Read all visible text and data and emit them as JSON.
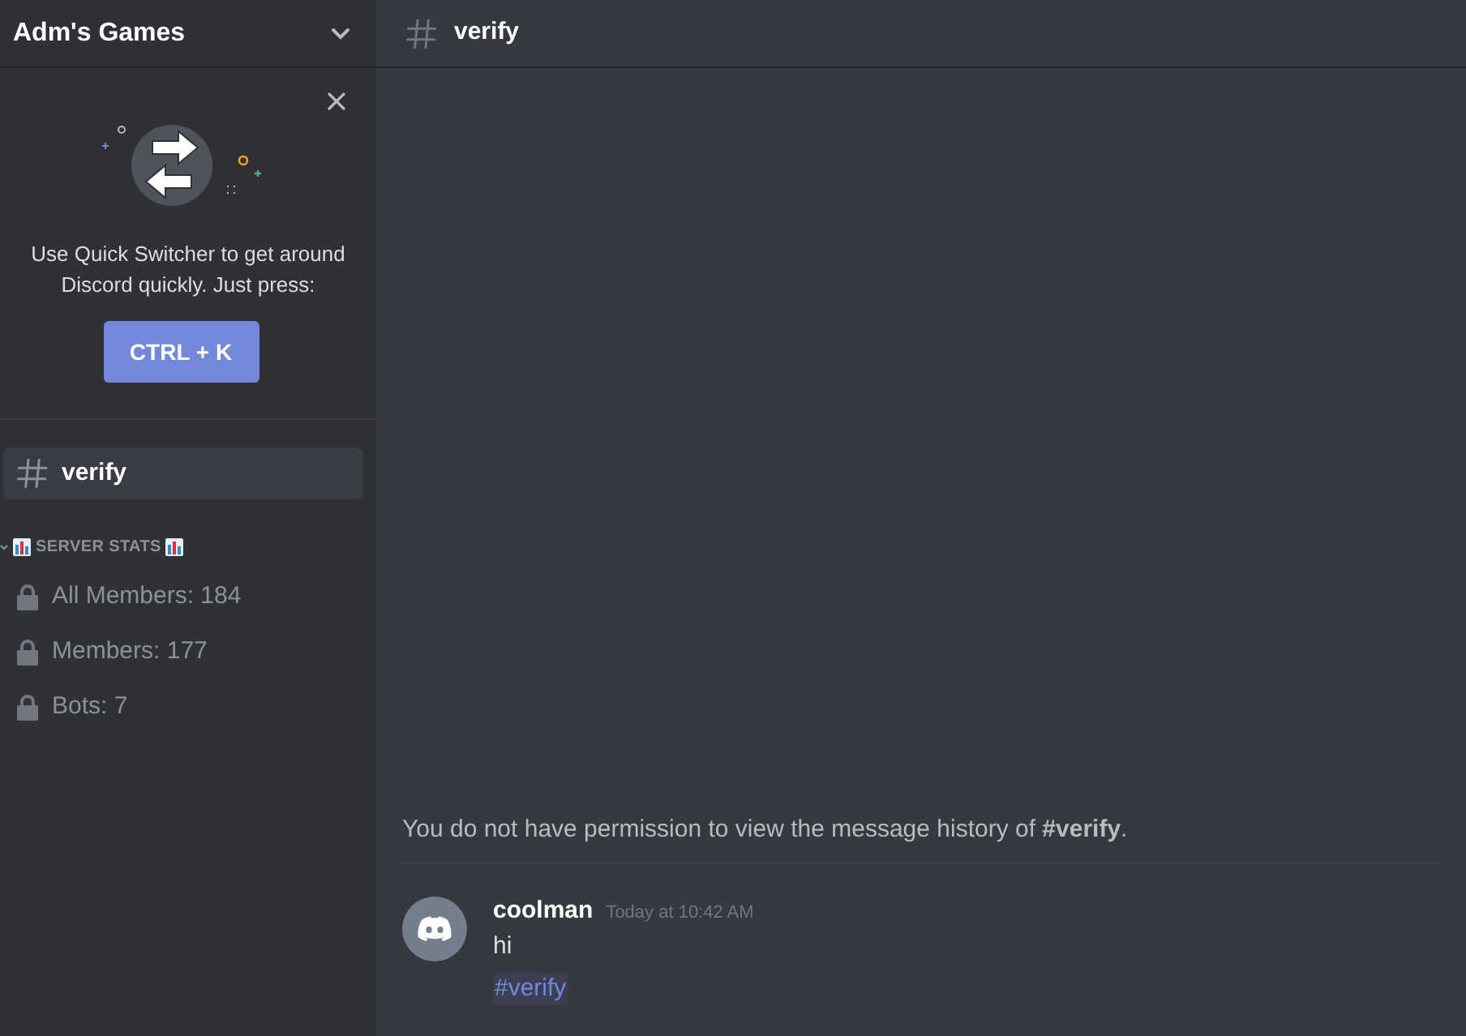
{
  "server": {
    "name": "Adm's Games"
  },
  "quick_switcher": {
    "text": "Use Quick Switcher to get around Discord quickly. Just press:",
    "shortcut": "CTRL + K"
  },
  "channels": [
    {
      "kind": "text",
      "name": "verify",
      "selected": true
    }
  ],
  "category": {
    "name": "SERVER STATS",
    "expanded": true,
    "channels": [
      {
        "kind": "locked",
        "name": "All Members: 184",
        "selected": false
      },
      {
        "kind": "locked",
        "name": "Members: 177",
        "selected": false
      },
      {
        "kind": "locked",
        "name": "Bots: 7",
        "selected": false
      }
    ]
  },
  "header": {
    "channel": "verify"
  },
  "notice": "You do not have permission to view the message history of **#verify**.",
  "messages": [
    {
      "author": "coolman",
      "timestamp": "Today at 10:42 AM",
      "content": "hi",
      "mention": "#verify"
    }
  ]
}
